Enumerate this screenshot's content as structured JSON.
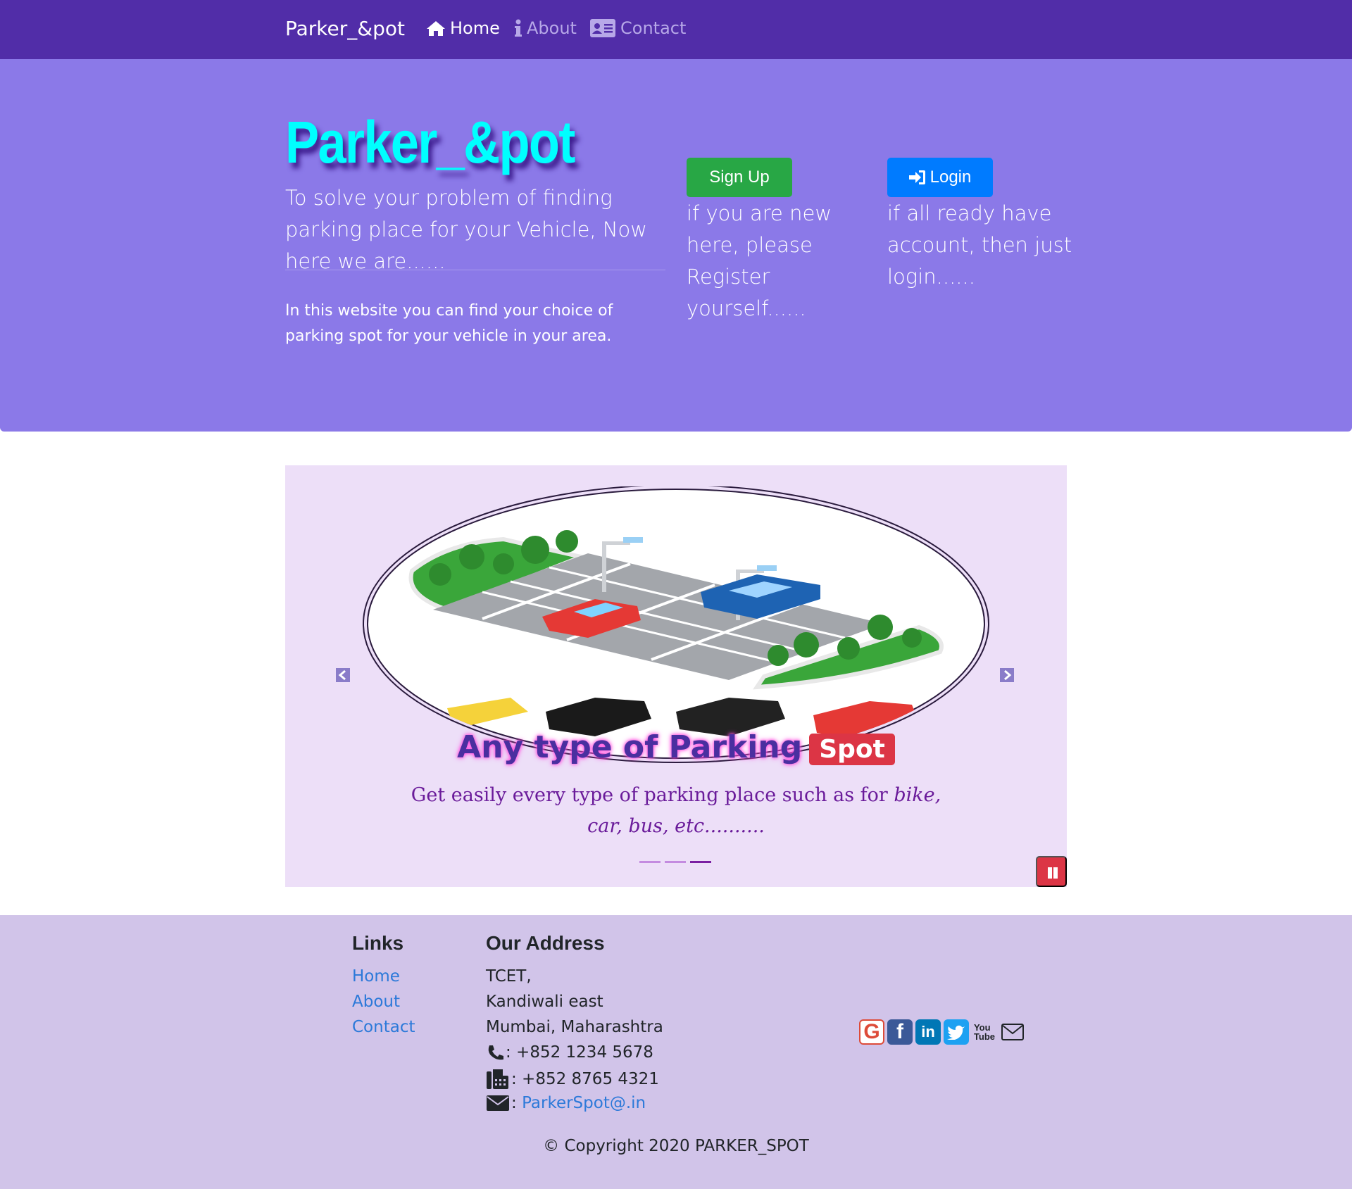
{
  "nav": {
    "brand": "Parker_&pot",
    "items": [
      {
        "label": "Home",
        "icon": "home-icon",
        "active": true
      },
      {
        "label": "About",
        "icon": "info-icon",
        "active": false
      },
      {
        "label": "Contact",
        "icon": "address-card-icon",
        "active": false
      }
    ]
  },
  "hero": {
    "title": "Parker_&pot",
    "subtitle": "To solve your problem of finding parking place for your Vehicle, Now here we are......",
    "description": "In this website you can find your choice of parking spot for your vehicle in your area.",
    "signup_label": "Sign Up",
    "signup_note": "if you are new here, please Register yourself......",
    "login_label": "Login",
    "login_note": "if all ready have account, then just login......"
  },
  "carousel": {
    "caption_title": "Any type of Parking",
    "caption_badge": "Spot",
    "caption_text_plain": "Get easily every type of parking place such as for ",
    "caption_text_italic": "bike, car, bus, etc..........",
    "slide_count": 3,
    "active_slide": 3
  },
  "footer": {
    "links_heading": "Links",
    "links": [
      "Home",
      "About",
      "Contact"
    ],
    "address_heading": "Our Address",
    "address_lines": [
      "TCET,",
      "Kandiwali east",
      "Mumbai, Maharashtra"
    ],
    "phone": ": +852 1234 5678",
    "fax": ": +852 8765 4321",
    "email_sep": ":",
    "email": "ParkerSpot@.in",
    "social": [
      "google-icon",
      "facebook-icon",
      "linkedin-icon",
      "twitter-icon",
      "youtube-icon",
      "mail-icon"
    ],
    "copyright": "© Copyright 2020 PARKER_SPOT"
  },
  "colors": {
    "navbar": "#512DA8",
    "jumbotron": "#8B79E8",
    "hero_title": "#00FFFF",
    "signup": "#28a745",
    "login": "#007bff",
    "carousel_bg": "#EDDFF8",
    "footer": "#D1C4E9"
  }
}
